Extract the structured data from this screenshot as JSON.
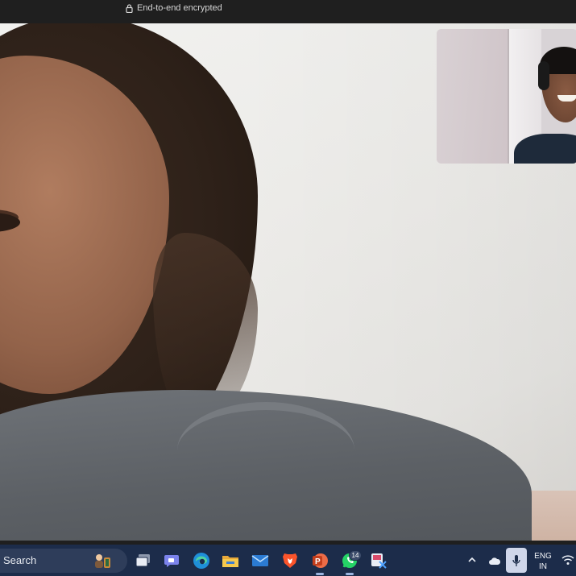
{
  "call": {
    "encryption_text": "End-to-end encrypted",
    "encryption_icon": "lock-icon"
  },
  "taskbar": {
    "search_label": "Search",
    "apps": [
      {
        "name": "task-view-icon"
      },
      {
        "name": "teams-chat-icon"
      },
      {
        "name": "edge-icon"
      },
      {
        "name": "file-explorer-icon"
      },
      {
        "name": "mail-icon"
      },
      {
        "name": "brave-icon"
      },
      {
        "name": "powerpoint-icon"
      },
      {
        "name": "whatsapp-icon"
      },
      {
        "name": "snipping-tool-icon"
      }
    ],
    "whatsapp_badge": "14",
    "tray": {
      "lang_line1": "ENG",
      "lang_line2": "IN"
    }
  },
  "colors": {
    "taskbar": "#1c2c4a",
    "whatsapp": "#25d366",
    "brave": "#fb542b",
    "powerpoint": "#c43e1c",
    "mic_highlight": "#cfd6ea"
  }
}
